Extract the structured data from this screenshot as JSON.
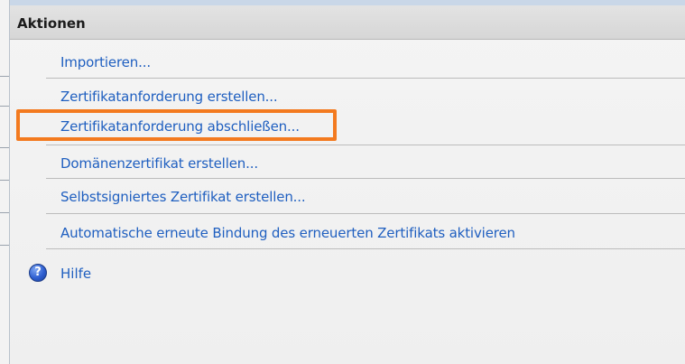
{
  "panel": {
    "title": "Aktionen"
  },
  "actions": [
    {
      "label": "Importieren..."
    },
    {
      "label": "Zertifikatanforderung erstellen..."
    },
    {
      "label": "Zertifikatanforderung abschließen..."
    },
    {
      "label": "Domänenzertifikat erstellen..."
    },
    {
      "label": "Selbstsigniertes Zertifikat erstellen..."
    },
    {
      "label": "Automatische erneute Bindung des erneuerten Zertifikats aktivieren"
    }
  ],
  "help": {
    "label": "Hilfe",
    "icon": "help-icon",
    "glyph": "?"
  },
  "colors": {
    "link": "#1f5fc0",
    "highlight": "#f37a1f",
    "header_bg": "#dcdcdc"
  }
}
